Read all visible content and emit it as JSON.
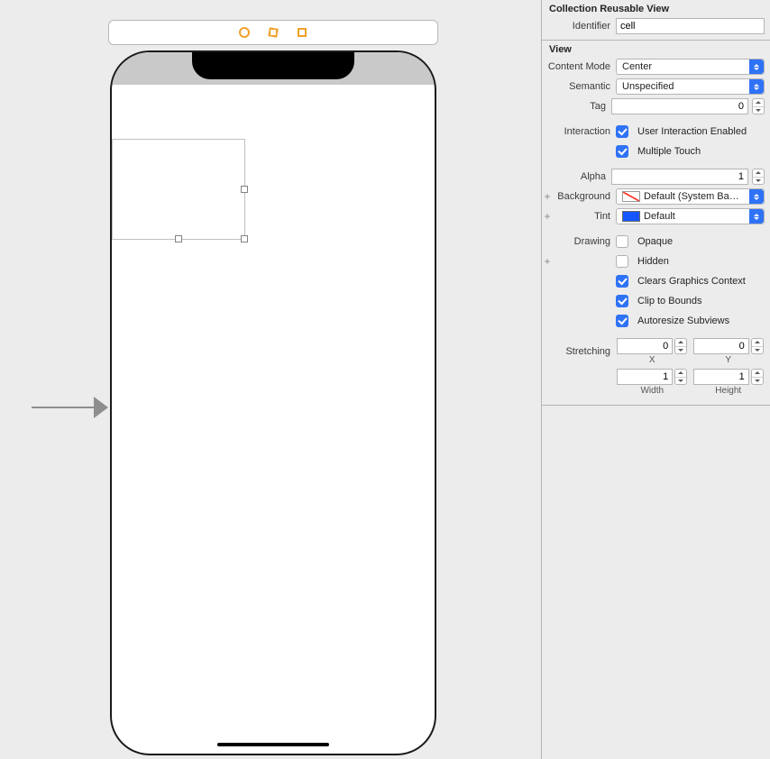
{
  "inspector": {
    "section1_title": "Collection Reusable View",
    "identifier": {
      "label": "Identifier",
      "value": "cell"
    },
    "section2_title": "View",
    "content_mode": {
      "label": "Content Mode",
      "value": "Center"
    },
    "semantic": {
      "label": "Semantic",
      "value": "Unspecified"
    },
    "tag": {
      "label": "Tag",
      "value": "0"
    },
    "interaction": {
      "label": "Interaction",
      "user_interaction": "User Interaction Enabled",
      "multiple_touch": "Multiple Touch"
    },
    "alpha": {
      "label": "Alpha",
      "value": "1"
    },
    "background": {
      "label": "Background",
      "value": "Default (System Ba…"
    },
    "tint": {
      "label": "Tint",
      "value": "Default"
    },
    "drawing": {
      "label": "Drawing",
      "opaque": "Opaque",
      "hidden": "Hidden",
      "clears": "Clears Graphics Context",
      "clip": "Clip to Bounds",
      "autoresize": "Autoresize Subviews"
    },
    "stretching": {
      "label": "Stretching",
      "x": "0",
      "y": "0",
      "w": "1",
      "h": "1",
      "xlabel": "X",
      "ylabel": "Y",
      "wlabel": "Width",
      "hlabel": "Height"
    }
  }
}
